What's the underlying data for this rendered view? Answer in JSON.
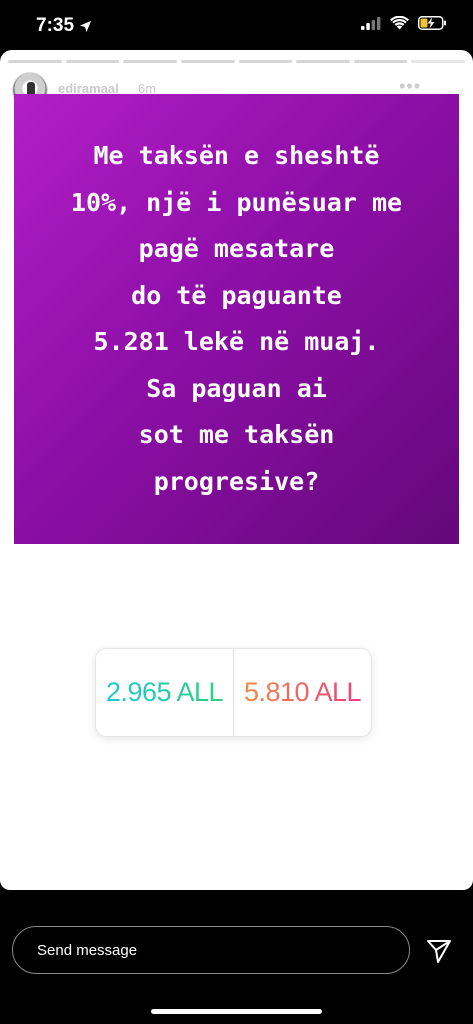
{
  "status_bar": {
    "time": "7:35"
  },
  "story": {
    "username": "ediramaal",
    "time_ago": "6m",
    "progress_segments": 8,
    "content_lines": [
      "Me taksën e sheshtë",
      "10%, një i punësuar me",
      "pagë mesatare",
      "do të paguante",
      "5.281 lekë në muaj.",
      "Sa paguan ai",
      "sot me taksën",
      "progresive?"
    ],
    "card_colors": {
      "start": "#b21ec6",
      "end": "#64087a"
    },
    "poll": {
      "option_a": "2.965 ALL",
      "option_b": "5.810 ALL"
    }
  },
  "footer": {
    "message_placeholder": "Send message"
  }
}
